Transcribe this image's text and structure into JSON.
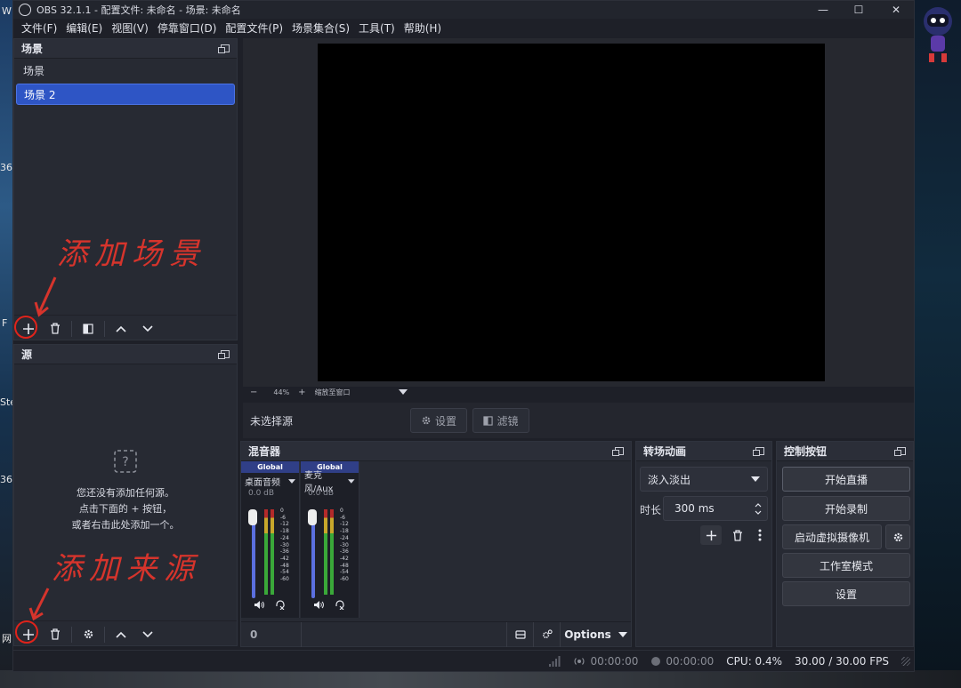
{
  "window": {
    "title": "OBS 32.1.1 - 配置文件: 未命名 - 场景: 未命名",
    "minimize_label": "—",
    "maximize_label": "☐",
    "close_label": "✕"
  },
  "menubar": {
    "items": [
      "文件(F)",
      "编辑(E)",
      "视图(V)",
      "停靠窗口(D)",
      "配置文件(P)",
      "场景集合(S)",
      "工具(T)",
      "帮助(H)"
    ]
  },
  "scenes": {
    "header": "场景",
    "items": [
      {
        "label": "场景",
        "selected": false
      },
      {
        "label": "场景 2",
        "selected": true
      }
    ]
  },
  "sources": {
    "header": "源",
    "empty_line1": "您还没有添加任何源。",
    "empty_line2": "点击下面的 + 按钮，",
    "empty_line3": "或者右击此处添加一个。"
  },
  "preview": {
    "zoom_minus": "−",
    "zoom_value": "44%",
    "zoom_plus": "+",
    "zoom_mode": "缩放至窗口"
  },
  "source_bar": {
    "no_source": "未选择源",
    "settings_label": "设置",
    "filters_label": "滤镜"
  },
  "mixer": {
    "header": "混音器",
    "channels": [
      {
        "track": "Global",
        "name": "桌面音频",
        "db": "0.0 dB",
        "level_db": 0
      },
      {
        "track": "Global",
        "name": "麦克风/Aux",
        "db": "0.0 dB",
        "level_db": 0
      }
    ],
    "scale": [
      "0",
      "-6",
      "-12",
      "-18",
      "-24",
      "-30",
      "-36",
      "-42",
      "-48",
      "-54",
      "-60"
    ],
    "hidden_label": "0 hidden",
    "options_label": "Options"
  },
  "transitions": {
    "header": "转场动画",
    "selected": "淡入淡出",
    "duration_label": "时长",
    "duration_value": "300 ms"
  },
  "controls": {
    "header": "控制按钮",
    "start_stream": "开始直播",
    "start_record": "开始录制",
    "virtual_cam": "启动虚拟摄像机",
    "studio_mode": "工作室模式",
    "settings": "设置"
  },
  "statusbar": {
    "stream_time": "00:00:00",
    "record_time": "00:00:00",
    "cpu": "CPU: 0.4%",
    "fps": "30.00 / 30.00 FPS"
  },
  "annotations": {
    "add_scene": "添加场景",
    "add_source": "添加来源",
    "color": "#d6342c"
  },
  "desktop": {
    "frag1": "W",
    "frag2": "36",
    "frag3": "F",
    "frag4": "Ste",
    "frag5": "36",
    "frag6": "网"
  }
}
